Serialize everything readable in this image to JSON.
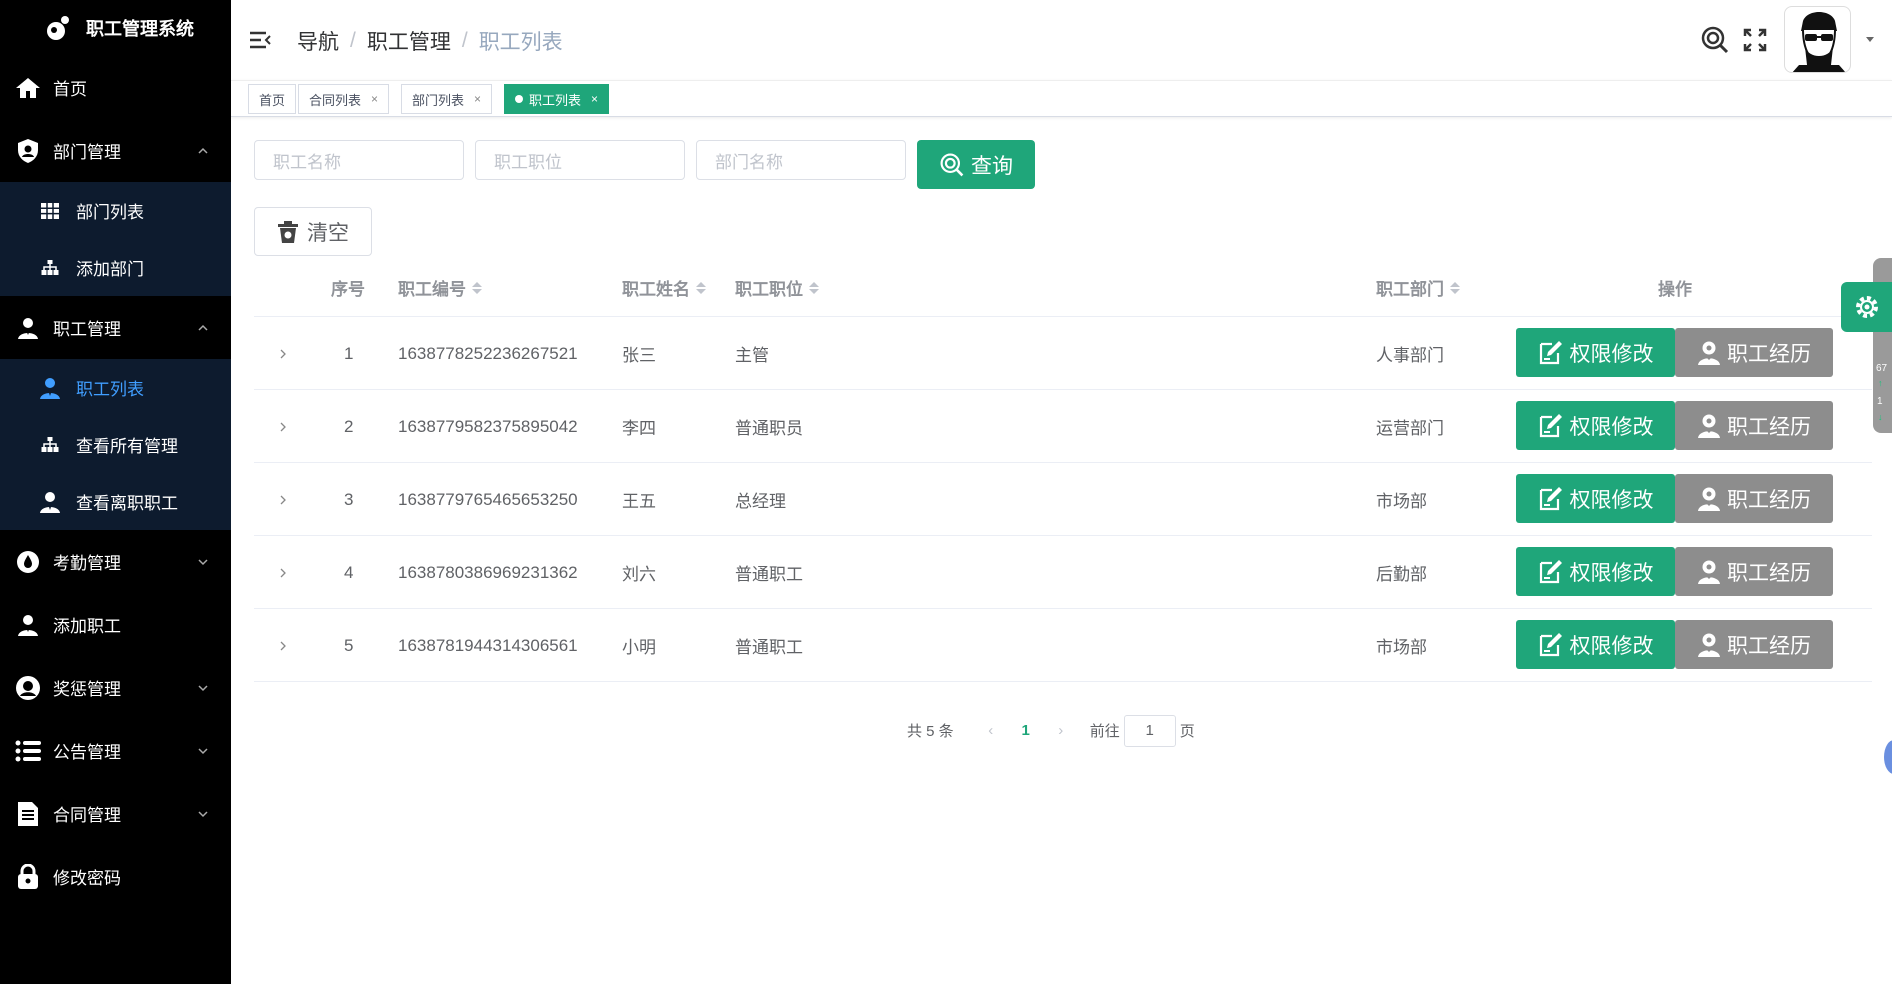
{
  "app": {
    "title": "职工管理系统"
  },
  "sidebar": {
    "items": [
      {
        "label": "首页",
        "icon": "home-icon"
      },
      {
        "label": "部门管理",
        "icon": "shield-icon",
        "expanded": true,
        "children": [
          {
            "label": "部门列表",
            "icon": "grid-icon"
          },
          {
            "label": "添加部门",
            "icon": "sitemap-icon"
          }
        ]
      },
      {
        "label": "职工管理",
        "icon": "user-icon",
        "expanded": true,
        "children": [
          {
            "label": "职工列表",
            "icon": "user-tie-icon",
            "active": true
          },
          {
            "label": "查看所有管理",
            "icon": "sitemap-icon"
          },
          {
            "label": "查看离职职工",
            "icon": "user-tie-icon"
          }
        ]
      },
      {
        "label": "考勤管理",
        "icon": "drop-icon",
        "expanded": false
      },
      {
        "label": "添加职工",
        "icon": "user-icon"
      },
      {
        "label": "奖惩管理",
        "icon": "face-icon",
        "expanded": false
      },
      {
        "label": "公告管理",
        "icon": "list-icon",
        "expanded": false
      },
      {
        "label": "合同管理",
        "icon": "document-icon",
        "expanded": false
      },
      {
        "label": "修改密码",
        "icon": "lock-icon"
      }
    ]
  },
  "breadcrumb": {
    "items": [
      "导航",
      "职工管理",
      "职工列表"
    ]
  },
  "tags": [
    {
      "label": "首页"
    },
    {
      "label": "合同列表",
      "close": "×"
    },
    {
      "label": "部门列表",
      "close": "×"
    },
    {
      "label": "职工列表",
      "close": "×",
      "active": true
    }
  ],
  "search": {
    "name_placeholder": "职工名称",
    "position_placeholder": "职工职位",
    "dept_placeholder": "部门名称",
    "query_label": "查询",
    "clear_label": "清空"
  },
  "table": {
    "columns": {
      "index": "序号",
      "id": "职工编号",
      "name": "职工姓名",
      "position": "职工职位",
      "dept": "职工部门",
      "ops": "操作"
    },
    "rows": [
      {
        "index": "1",
        "id": "1638778252236267521",
        "name": "张三",
        "position": "主管",
        "dept": "人事部门"
      },
      {
        "index": "2",
        "id": "1638779582375895042",
        "name": "李四",
        "position": "普通职员",
        "dept": "运营部门"
      },
      {
        "index": "3",
        "id": "1638779765465653250",
        "name": "王五",
        "position": "总经理",
        "dept": "市场部"
      },
      {
        "index": "4",
        "id": "1638780386969231362",
        "name": "刘六",
        "position": "普通职工",
        "dept": "后勤部"
      },
      {
        "index": "5",
        "id": "1638781944314306561",
        "name": "小明",
        "position": "普通职工",
        "dept": "市场部"
      }
    ],
    "perm_label": "权限修改",
    "history_label": "职工经历"
  },
  "pager": {
    "total": "共 5 条",
    "current": "1",
    "goto": "前往",
    "jump_value": "1",
    "page_unit": "页",
    "prev": "‹",
    "next": "›"
  },
  "float_panel": {
    "a": "67",
    "b": "1",
    "up": "↑",
    "down": "↓"
  },
  "colors": {
    "primary": "#1fa67a",
    "sidebar": "#000000",
    "submenu": "#0d1b2e",
    "active_link": "#409eff",
    "gray_button": "#8d8d8d"
  }
}
